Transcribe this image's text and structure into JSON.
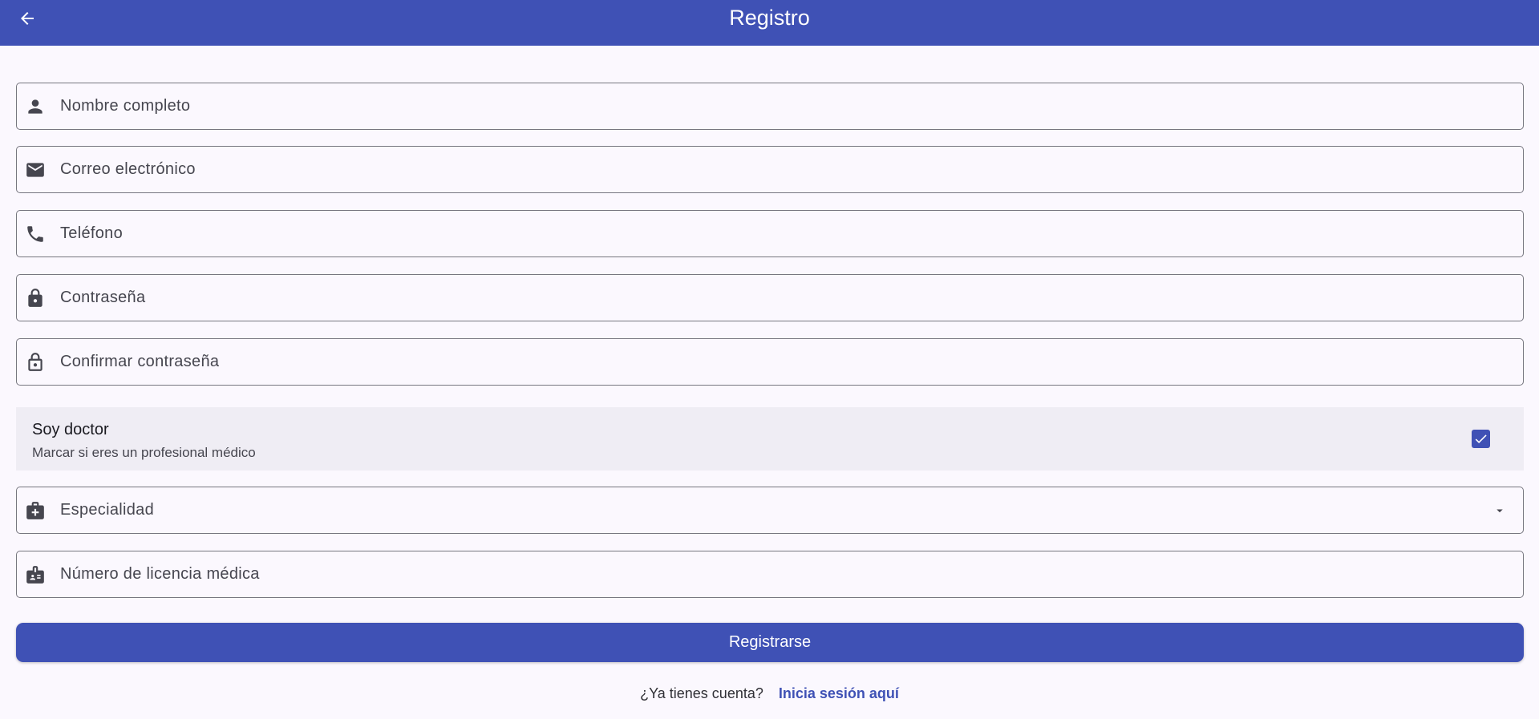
{
  "appbar": {
    "title": "Registro",
    "back_icon": "arrow-back-icon",
    "color": "#3f51b5"
  },
  "form": {
    "fields": [
      {
        "name": "full-name-field",
        "icon": "person-icon",
        "label": "Nombre completo"
      },
      {
        "name": "email-field",
        "icon": "mail-icon",
        "label": "Correo electrónico"
      },
      {
        "name": "phone-field",
        "icon": "phone-icon",
        "label": "Teléfono"
      },
      {
        "name": "password-field",
        "icon": "lock-icon",
        "label": "Contraseña"
      },
      {
        "name": "confirm-password-field",
        "icon": "lock-outline-icon",
        "label": "Confirmar contraseña"
      }
    ],
    "doctor_toggle": {
      "title": "Soy doctor",
      "subtitle": "Marcar si eres un profesional médico",
      "checked": true
    },
    "specialty": {
      "icon": "medical-bag-icon",
      "label": "Especialidad",
      "arrow_icon": "arrow-drop-down-icon"
    },
    "license": {
      "icon": "badge-icon",
      "label": "Número de licencia médica"
    },
    "submit_label": "Registrarse"
  },
  "footer": {
    "question": "¿Ya tienes cuenta?",
    "link": "Inicia sesión aquí"
  }
}
